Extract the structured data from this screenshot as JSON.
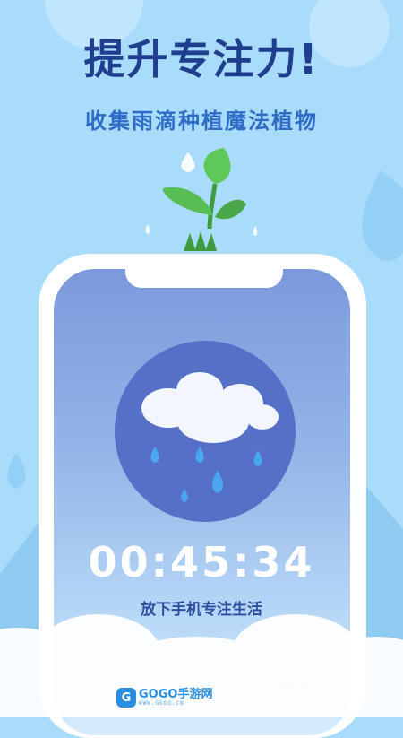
{
  "headline": "提升专注力!",
  "subline": "收集雨滴种植魔法植物",
  "timer": "00:45:34",
  "caption": "放下手机专注生活",
  "watermark": {
    "logo_glyph": "G",
    "brand": "GOGO手游网",
    "domain": "WWW.GOGO.CN"
  },
  "icons": [
    "plant-sprout-icon",
    "raindrop-icon",
    "rain-cloud-icon"
  ],
  "colors": {
    "background": "#a9dcfb",
    "headline": "#1f3f8e",
    "subline": "#2f6cc6",
    "circle": "#5670c7",
    "leaf": "#4cb64a",
    "raindrop": "#4aa7f0"
  }
}
